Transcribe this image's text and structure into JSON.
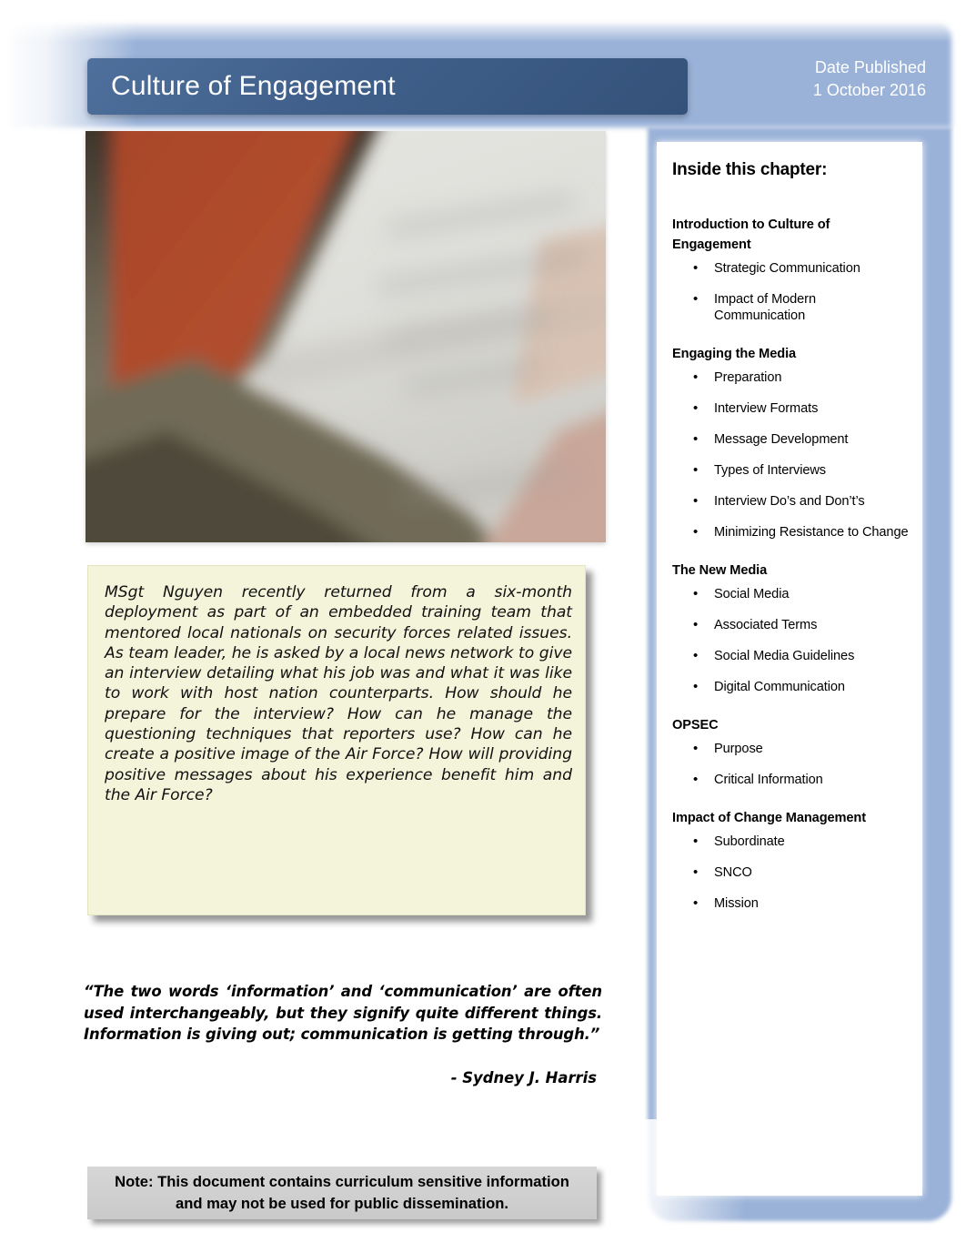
{
  "colors": {
    "title_bar_dark": "#3f5f8a",
    "band_light_blue": "#9ab2d8",
    "scenario_bg": "#f4f4da",
    "note_bg": "#d2d2d2"
  },
  "header": {
    "title": "Culture of Engagement",
    "date_label": "Date Published",
    "date_value": "1 October 2016"
  },
  "photo": {
    "alt_name": "blurred-photo-of-documents-and-uniform"
  },
  "scenario": {
    "text": "MSgt Nguyen recently returned from a six-month deployment as part of an embedded training team that mentored local nationals on security forces related issues.  As team leader, he is asked by a local news network to give an interview detailing what his job was and what it was like to work with host nation counterparts.  How should he prepare for the interview?  How can he manage the questioning techniques that reporters use?  How can he create a positive image of the Air Force?  How will providing positive messages about his experience benefit him and the Air Force?"
  },
  "quote": {
    "text": "“The two words ‘information’ and ‘communication’ are often used interchangeably, but they signify quite different things. Information is giving out; communication is getting through.”",
    "attribution": "- Sydney J. Harris"
  },
  "note": {
    "text": "Note: This document contains curriculum sensitive information and may not be used for public dissemination."
  },
  "sidebar": {
    "title": "Inside this chapter:",
    "bullet_glyph": "•",
    "sections": [
      {
        "heading": "Introduction to Culture of Engagement",
        "items": [
          "Strategic Communication",
          "Impact of Modern Communication"
        ]
      },
      {
        "heading": "Engaging the Media",
        "items": [
          "Preparation",
          "Interview Formats",
          "Message Development",
          "Types of Interviews",
          "Interview Do’s and Don’t’s",
          "Minimizing Resistance to Change"
        ]
      },
      {
        "heading": "The New Media",
        "items": [
          "Social Media",
          "Associated Terms",
          "Social Media Guidelines",
          "Digital Communication"
        ]
      },
      {
        "heading": "OPSEC",
        "items": [
          "Purpose",
          "Critical Information"
        ]
      },
      {
        "heading": "Impact of Change Management",
        "items": [
          "Subordinate",
          "SNCO",
          "Mission"
        ]
      }
    ]
  }
}
